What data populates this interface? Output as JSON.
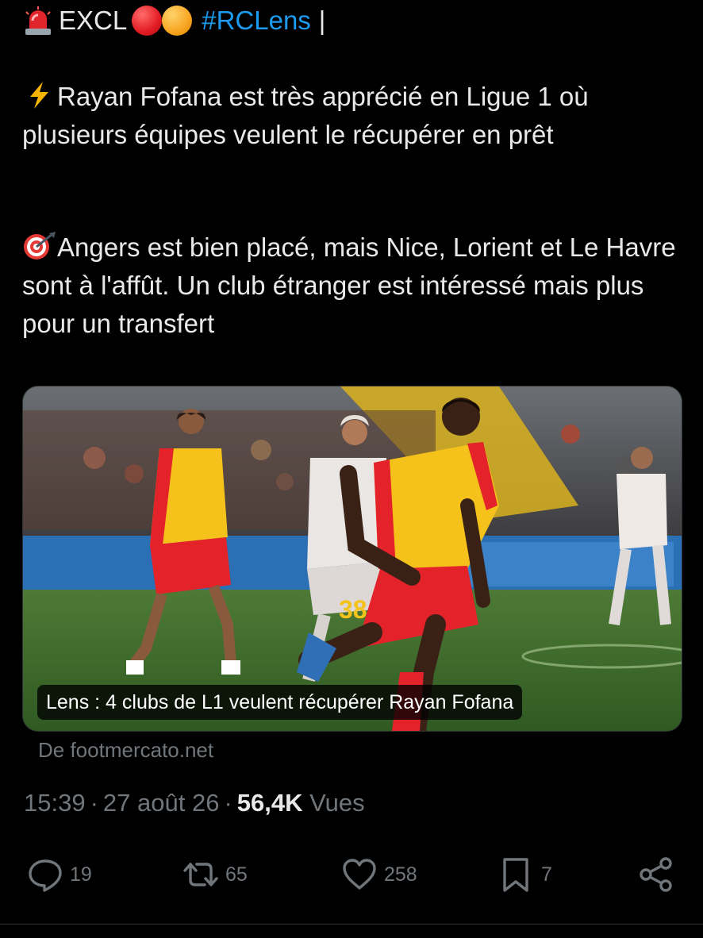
{
  "tweet": {
    "header": {
      "siren_icon": "police-light-icon",
      "prefix": "EXCL",
      "dot_colors": [
        "#e31b23",
        "#f7a521"
      ],
      "hashtag": "#RCLens",
      "suffix": "|"
    },
    "paragraph1": {
      "icon": "lightning-icon",
      "text": "Rayan Fofana est très apprécié en Ligue 1 où plusieurs équipes veulent le récupérer en prêt"
    },
    "paragraph2": {
      "icon": "target-icon",
      "text": "Angers est bien placé, mais Nice, Lorient et Le Havre sont à l'affût. Un club étranger est intéressé mais plus pour un transfert"
    },
    "card": {
      "caption": "Lens : 4 clubs de L1 veulent récupérer Rayan Fofana",
      "source": "De footmercato.net",
      "jersey_number": "38"
    },
    "meta": {
      "time": "15:39",
      "separator": "·",
      "date": "27 août 26",
      "views_count": "56,4K",
      "views_label": "Vues"
    },
    "actions": {
      "replies": "19",
      "retweets": "65",
      "likes": "258",
      "bookmarks": "7"
    },
    "colors": {
      "background": "#000000",
      "text": "#e7e9ea",
      "muted": "#71767b",
      "link": "#1d9bf0"
    }
  }
}
